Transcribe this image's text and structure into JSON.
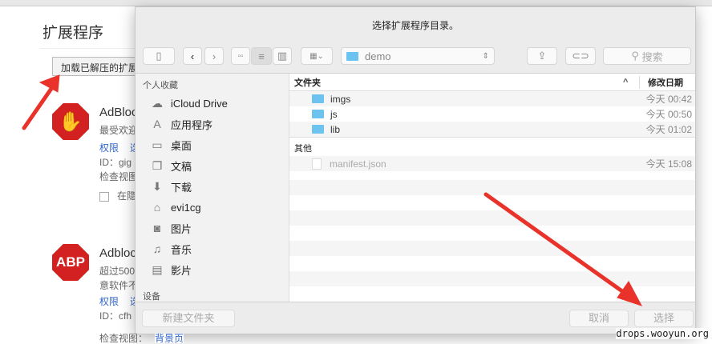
{
  "page": {
    "title": "扩展程序",
    "load_button": "加载已解压的扩展程序..."
  },
  "extensions": [
    {
      "name": "AdBlock",
      "desc": "最受欢迎",
      "link1": "权限",
      "link2": "选",
      "id": "ID：gig",
      "inspect": "检查视图",
      "incognito": "在隐"
    },
    {
      "name": "Adblock",
      "icon_text": "ABP",
      "desc": "超过500",
      "desc2": "意软件不",
      "link1": "权限",
      "link2": "选",
      "id": "ID：cfh",
      "inspect": "检查视图：",
      "inspect_link": "背景页"
    }
  ],
  "dialog": {
    "title": "选择扩展程序目录。",
    "location": "demo",
    "search_placeholder": "搜索",
    "sidebar": {
      "favorites_label": "个人收藏",
      "items": [
        "iCloud Drive",
        "应用程序",
        "桌面",
        "文稿",
        "下载",
        "evi1cg",
        "图片",
        "音乐",
        "影片"
      ],
      "devices_label": "设备"
    },
    "columns": {
      "name": "文件夹",
      "date": "修改日期"
    },
    "folders": [
      {
        "name": "imgs",
        "date": "今天 00:42"
      },
      {
        "name": "js",
        "date": "今天 00:50"
      },
      {
        "name": "lib",
        "date": "今天 01:02"
      }
    ],
    "other_label": "其他",
    "others": [
      {
        "name": "manifest.json",
        "date": "今天 15:08"
      }
    ],
    "new_folder": "新建文件夹",
    "cancel": "取消",
    "choose": "选择"
  },
  "watermark": "drops.wooyun.org",
  "colors": {
    "arrow": "#e8322a",
    "folder": "#6cc3f0"
  }
}
